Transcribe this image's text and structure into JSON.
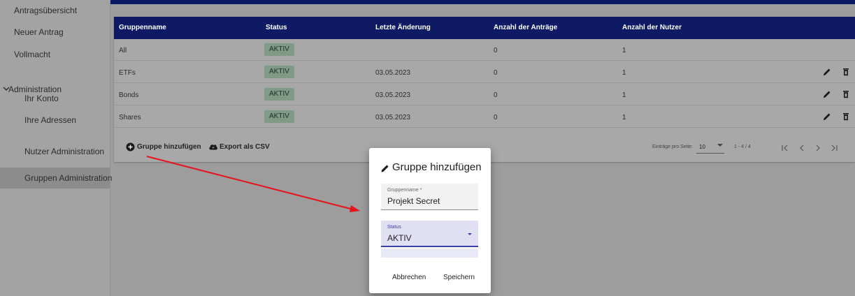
{
  "sidebar": {
    "items": [
      {
        "label": "Antragsübersicht"
      },
      {
        "label": "Neuer Antrag"
      },
      {
        "label": "Vollmacht"
      },
      {
        "label": "Administration"
      },
      {
        "label": "Ihr Konto"
      },
      {
        "label": "Ihre Adressen"
      },
      {
        "label": "Nutzer Administration"
      },
      {
        "label": "Gruppen Administration"
      }
    ]
  },
  "table": {
    "columns": [
      "Gruppenname",
      "Status",
      "Letzte Änderung",
      "Anzahl der Anträge",
      "Anzahl der Nutzer"
    ],
    "rows": [
      {
        "name": "All",
        "status": "AKTIV",
        "date": "",
        "antraege": "0",
        "nutzer": "1"
      },
      {
        "name": "ETFs",
        "status": "AKTIV",
        "date": "03.05.2023",
        "antraege": "0",
        "nutzer": "1"
      },
      {
        "name": "Bonds",
        "status": "AKTIV",
        "date": "03.05.2023",
        "antraege": "0",
        "nutzer": "1"
      },
      {
        "name": "Shares",
        "status": "AKTIV",
        "date": "03.05.2023",
        "antraege": "0",
        "nutzer": "1"
      }
    ]
  },
  "footer": {
    "add_label": "Gruppe hinzufügen",
    "export_label": "Export als CSV",
    "per_page_label": "Einträge pro Seite:",
    "per_page_value": "10",
    "range": "1 - 4 / 4"
  },
  "dialog": {
    "title": "Gruppe hinzufügen",
    "name_label": "Gruppenname *",
    "name_value": "Projekt Secret",
    "status_label": "Status",
    "status_value": "AKTIV",
    "cancel": "Abbrechen",
    "save": "Speichern"
  },
  "colors": {
    "header": "#0e1a64",
    "badge": "#7f9b88",
    "arrow": "#e8121b",
    "select_accent": "#3b3fb0"
  }
}
